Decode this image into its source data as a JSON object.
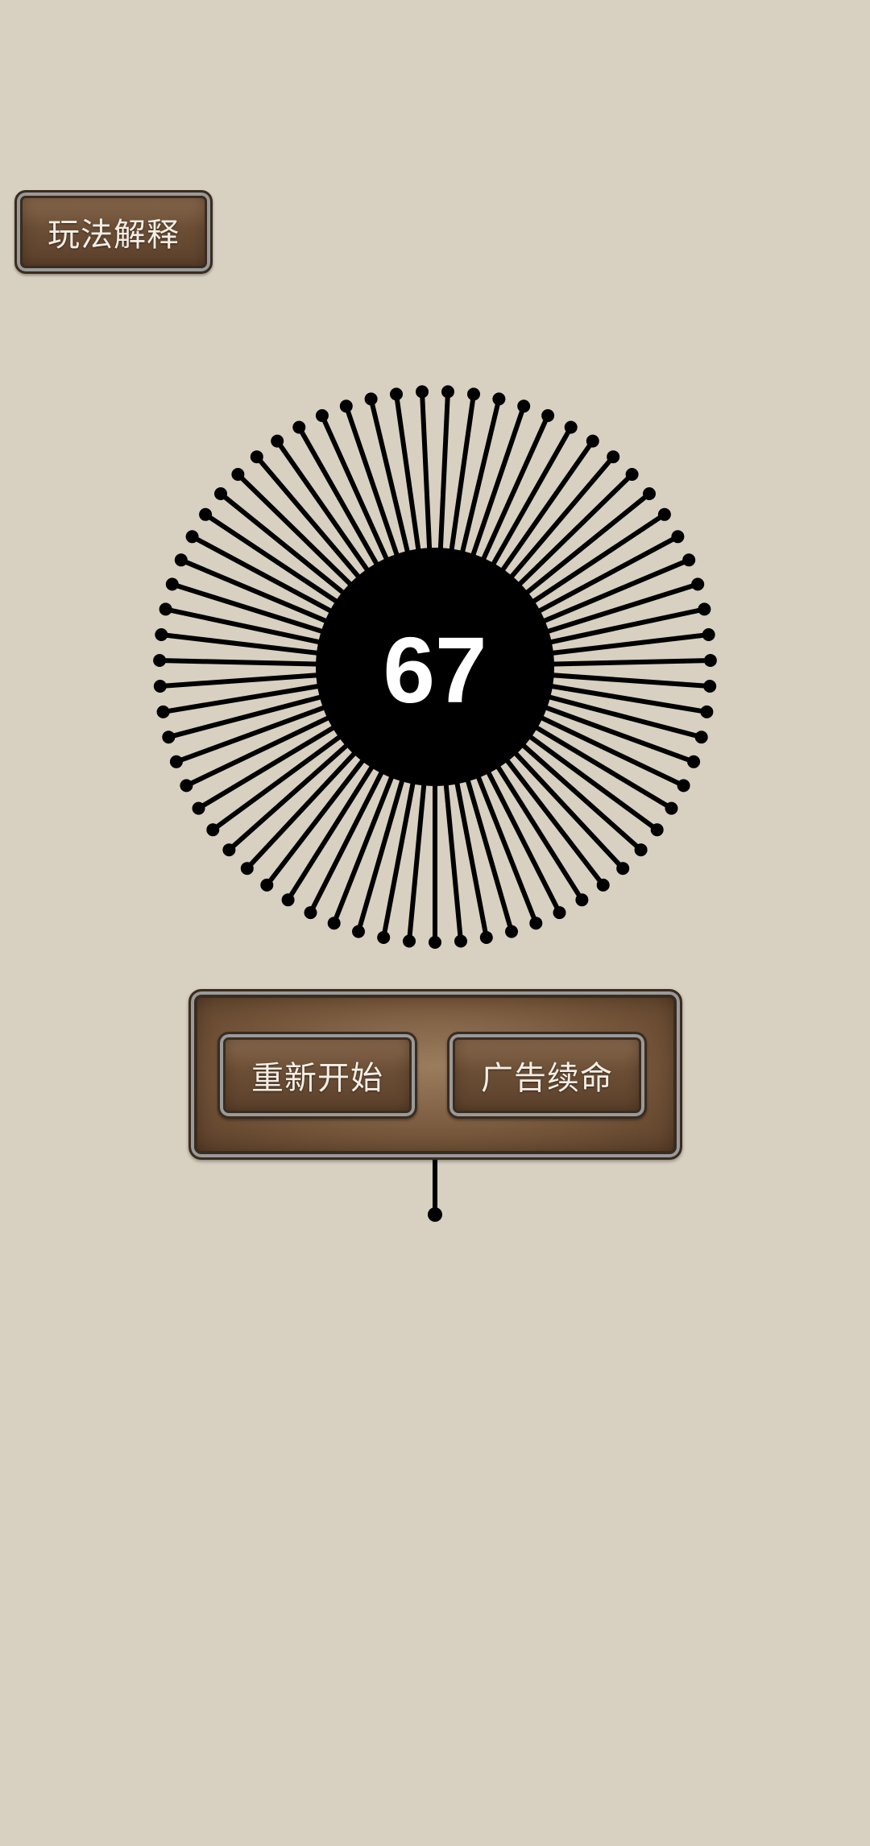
{
  "help": {
    "label": "玩法解释"
  },
  "game": {
    "score": "67",
    "pins_on_wheel": 67,
    "pins_remaining": 1
  },
  "panel": {
    "restart_label": "重新开始",
    "continue_label": "广告续命"
  },
  "colors": {
    "background": "#d8d0c0",
    "pin": "#000000",
    "wood": "#6b4e35",
    "button_text": "#f4eee6"
  }
}
